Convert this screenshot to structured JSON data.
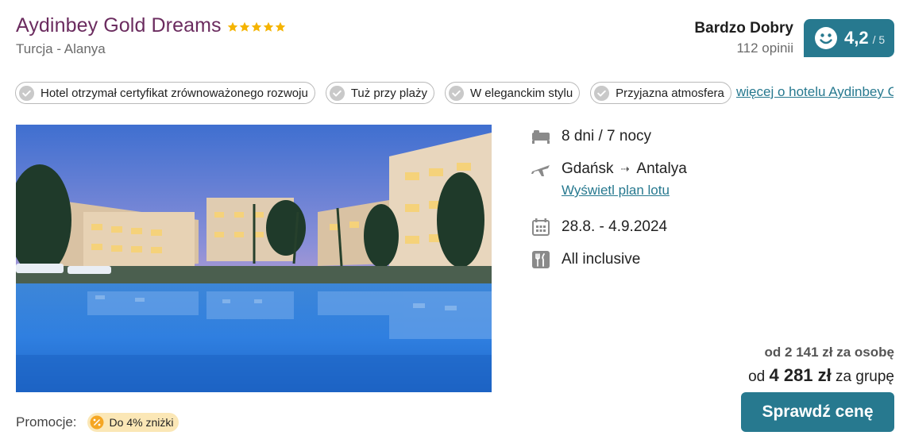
{
  "hotel": {
    "name": "Aydinbey Gold Dreams",
    "stars": 5,
    "location": "Turcja - Alanya"
  },
  "rating": {
    "label": "Bardzo Dobry",
    "count": "112 opinii",
    "score": "4,2",
    "max": "/ 5",
    "badge_color": "#27798f"
  },
  "tags": [
    "Hotel otrzymał certyfikat zrównoważonego rozwoju",
    "Tuż przy plaży",
    "W eleganckim stylu",
    "Przyjazna atmosfera"
  ],
  "more_link": "więcej o hotelu Aydinbey Gold Dreams",
  "trip": {
    "duration": "8 dni / 7 nocy",
    "from": "Gdańsk",
    "to": "Antalya",
    "flight_plan_link": "Wyświetl plan lotu",
    "dates": "28.8. - 4.9.2024",
    "board": "All inclusive"
  },
  "price": {
    "per_person": "od 2 141 zł za osobę",
    "group_prefix": "od",
    "group_amount": "4 281 zł",
    "group_suffix": "za grupę"
  },
  "cta_label": "Sprawdź cenę",
  "promo": {
    "label": "Promocje:",
    "badge": "Do 4% zniżki"
  },
  "colors": {
    "title": "#6b2c5f",
    "accent": "#27798f",
    "star": "#f5b400",
    "promo_bg": "#fbe7b6"
  },
  "icons": {
    "stars": "star-icon",
    "rating": "smiley-icon",
    "tags": "check-circle-icon",
    "duration": "bed-icon",
    "flight": "plane-icon",
    "dates": "calendar-icon",
    "board": "cutlery-icon",
    "promo": "discount-icon"
  }
}
